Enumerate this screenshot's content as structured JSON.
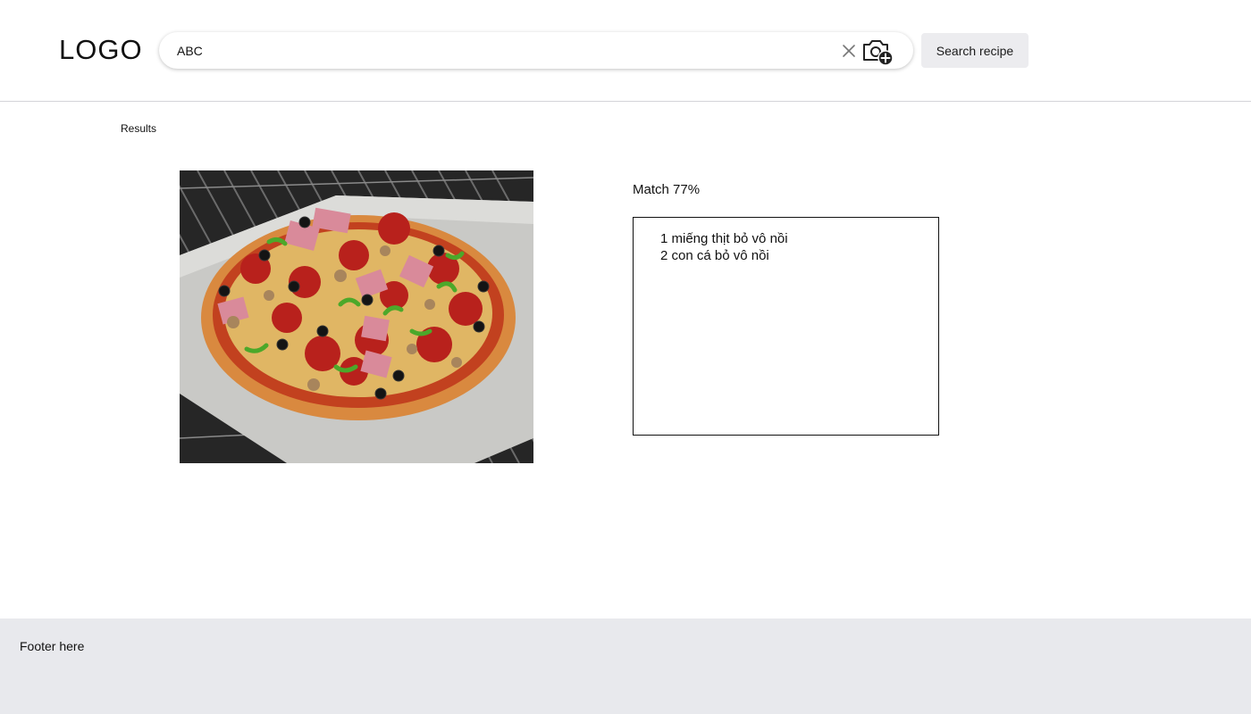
{
  "header": {
    "logo": "LOGO",
    "search": {
      "value": "ABC",
      "clear_icon": "close-icon",
      "camera_icon": "camera-add-icon"
    },
    "search_button_label": "Search recipe"
  },
  "main": {
    "results_label": "Results",
    "image": {
      "subject": "pizza"
    },
    "match_label": "Match 77%",
    "match_percent": 77,
    "ingredients": [
      "1 miếng thịt bỏ vô nồi",
      "2 con cá bỏ vô nồi"
    ]
  },
  "footer": {
    "text": "Footer here"
  },
  "colors": {
    "footer_bg": "#e8e9ed",
    "button_bg": "#ececef",
    "header_divider": "#d4d4d8"
  }
}
